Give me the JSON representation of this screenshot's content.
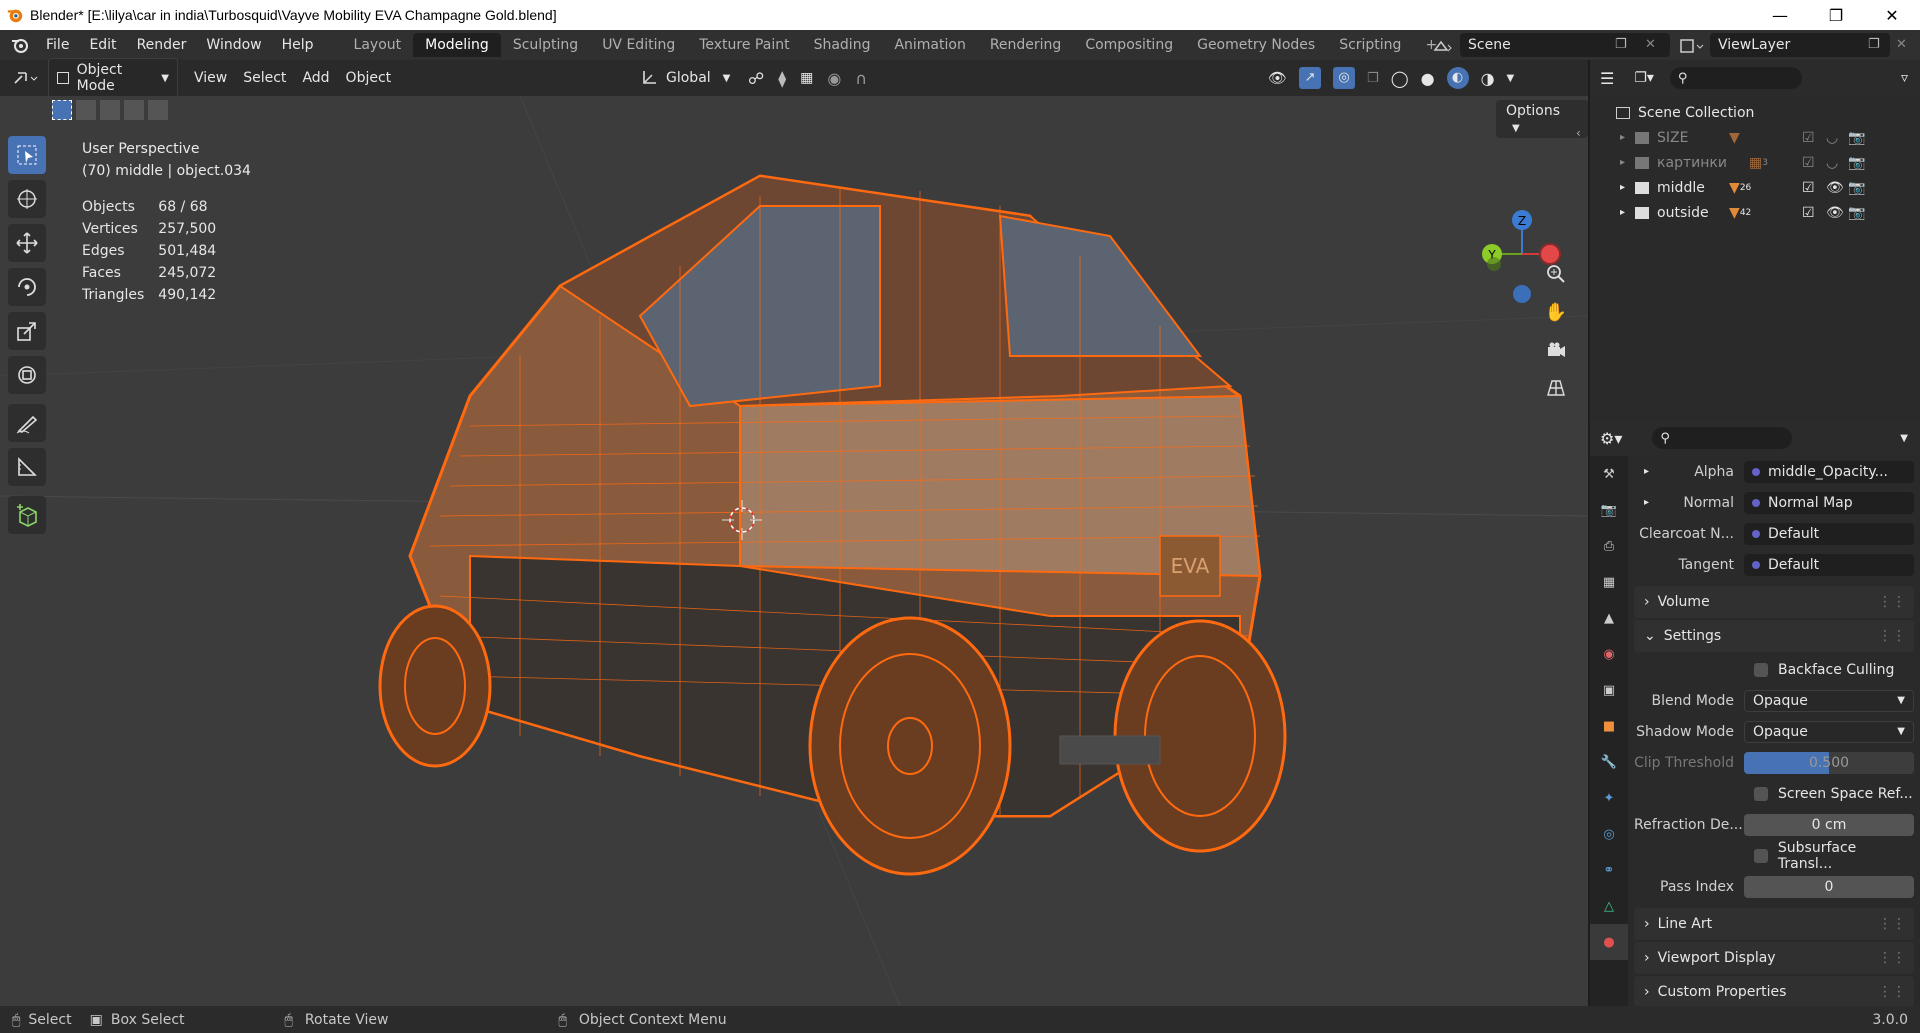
{
  "window": {
    "title": "Blender* [E:\\lilya\\car in india\\Turbosquid\\Vayve Mobility EVA Champagne Gold.blend]"
  },
  "menu": {
    "items": [
      "File",
      "Edit",
      "Render",
      "Window",
      "Help"
    ],
    "workspaces": [
      "Layout",
      "Modeling",
      "Sculpting",
      "UV Editing",
      "Texture Paint",
      "Shading",
      "Animation",
      "Rendering",
      "Compositing",
      "Geometry Nodes",
      "Scripting"
    ],
    "active_workspace": "Modeling",
    "scene": "Scene",
    "view_layer": "ViewLayer"
  },
  "viewport_header": {
    "mode": "Object Mode",
    "menus": [
      "View",
      "Select",
      "Add",
      "Object"
    ],
    "orientation": "Global",
    "options_label": "Options"
  },
  "viewport": {
    "perspective": "User Perspective",
    "active": "(70) middle | object.034",
    "stats": [
      {
        "label": "Objects",
        "value": "68 / 68"
      },
      {
        "label": "Vertices",
        "value": "257,500"
      },
      {
        "label": "Edges",
        "value": "501,484"
      },
      {
        "label": "Faces",
        "value": "245,072"
      },
      {
        "label": "Triangles",
        "value": "490,142"
      }
    ],
    "gizmo_axes": {
      "z": "Z",
      "y": "Y"
    },
    "badge_text": "EVA"
  },
  "outliner": {
    "root": "Scene Collection",
    "collections": [
      {
        "name": "SIZE",
        "count": "",
        "dim": true
      },
      {
        "name": "картинки",
        "count": "3",
        "dim": true
      },
      {
        "name": "middle",
        "count": "26",
        "dim": false
      },
      {
        "name": "outside",
        "count": "42",
        "dim": false
      }
    ]
  },
  "properties": {
    "inputs": [
      {
        "label": "Alpha",
        "value": "middle_Opacity..."
      },
      {
        "label": "Normal",
        "value": "Normal Map"
      },
      {
        "label": "Clearcoat N...",
        "value": "Default"
      },
      {
        "label": "Tangent",
        "value": "Default"
      }
    ],
    "sections": {
      "volume": "Volume",
      "settings": "Settings",
      "line_art": "Line Art",
      "viewport_display": "Viewport Display",
      "custom_properties": "Custom Properties"
    },
    "settings": {
      "backface_culling": "Backface Culling",
      "blend_mode_label": "Blend Mode",
      "blend_mode": "Opaque",
      "shadow_mode_label": "Shadow Mode",
      "shadow_mode": "Opaque",
      "clip_threshold_label": "Clip Threshold",
      "clip_threshold": "0.500",
      "ssr": "Screen Space Ref...",
      "refraction_label": "Refraction De...",
      "refraction": "0 cm",
      "subsurface": "Subsurface Transl...",
      "pass_index_label": "Pass Index",
      "pass_index": "0"
    }
  },
  "statusbar": {
    "select": "Select",
    "box_select": "Box Select",
    "rotate": "Rotate View",
    "context": "Object Context Menu",
    "version": "3.0.0"
  }
}
